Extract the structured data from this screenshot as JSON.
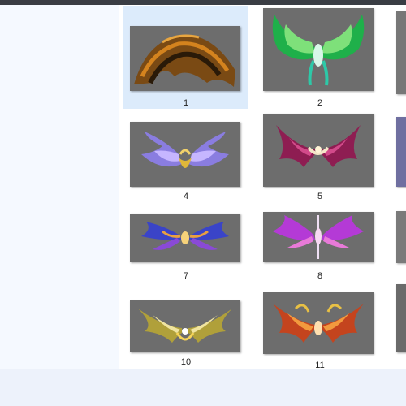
{
  "gallery": {
    "items": [
      {
        "label": "1"
      },
      {
        "label": "2"
      },
      {
        "label": "4"
      },
      {
        "label": "5"
      },
      {
        "label": "7"
      },
      {
        "label": "8"
      },
      {
        "label": "10"
      },
      {
        "label": "11"
      }
    ]
  },
  "colors": {
    "selected_bg": "#dcebfb",
    "thumb_bg": "#6d6d6d"
  }
}
